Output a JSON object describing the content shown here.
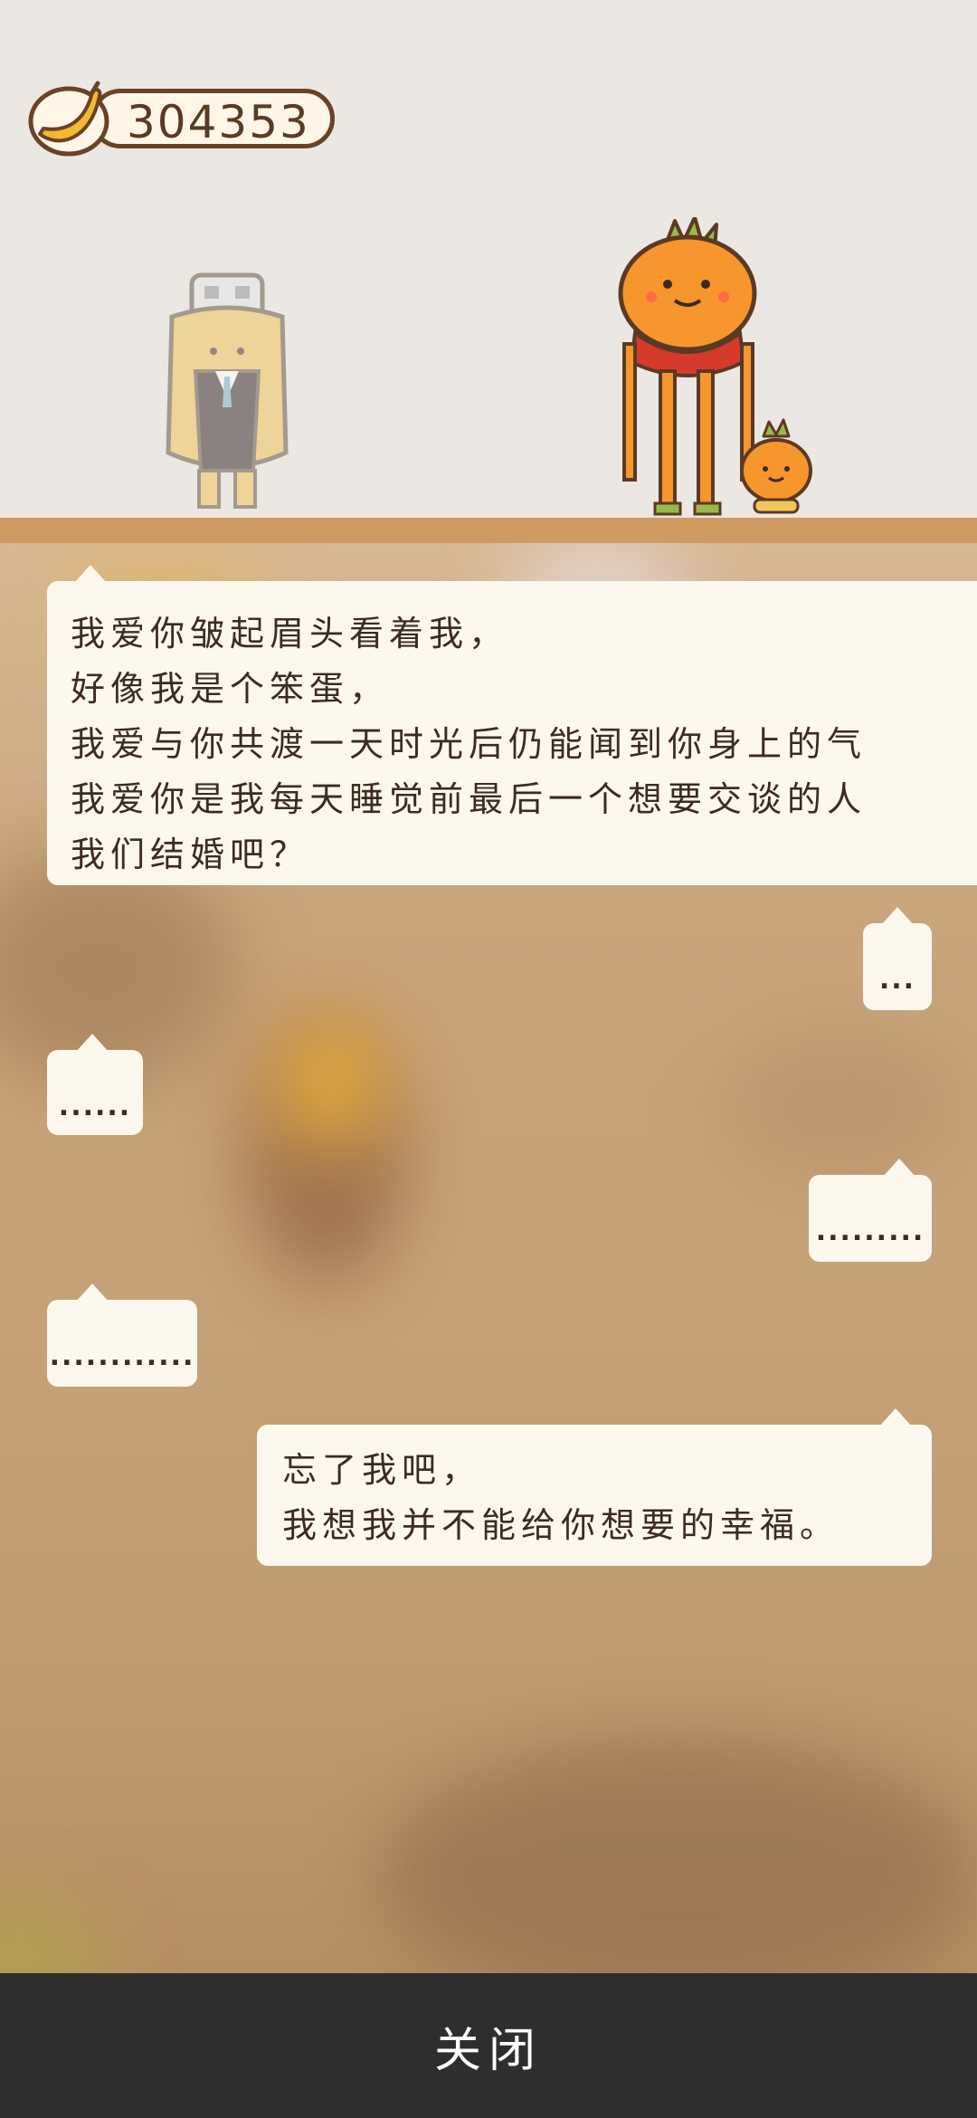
{
  "header": {
    "coin_value": "304353",
    "coin_icon": "banana-icon"
  },
  "dialog": {
    "messages": [
      {
        "side": "left",
        "lines": [
          "我爱你皱起眉头看着我，",
          "好像我是个笨蛋，",
          "我爱与你共渡一天时光后仍能闻到你身上的气",
          "我爱你是我每天睡觉前最后一个想要交谈的人",
          "我们结婚吧？"
        ]
      },
      {
        "side": "right",
        "text": "..."
      },
      {
        "side": "left",
        "text": "......"
      },
      {
        "side": "right",
        "text": "........."
      },
      {
        "side": "left",
        "text": "............"
      },
      {
        "side": "right",
        "lines": [
          "忘了我吧，",
          "我想我并不能给你想要的幸福。"
        ]
      }
    ]
  },
  "footer": {
    "close_label": "关闭"
  },
  "colors": {
    "accent_brown": "#6b4226",
    "ground": "#cf9a62",
    "bottom_bar": "#2e2e2e",
    "bubble": "#fdf8ee"
  }
}
